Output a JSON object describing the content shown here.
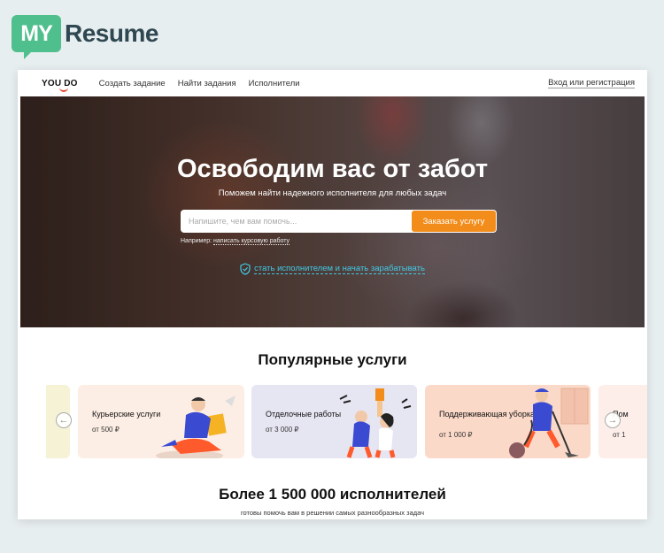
{
  "logo": {
    "badge": "MY",
    "text": "Resume"
  },
  "nav": {
    "brand": "YOU DO",
    "links": [
      "Создать задание",
      "Найти задания",
      "Исполнители"
    ],
    "login": "Вход или регистрация"
  },
  "hero": {
    "title": "Освободим вас от забот",
    "subtitle": "Поможем найти надежного исполнителя для любых задач",
    "search_placeholder": "Напишите, чем вам помочь...",
    "order_button": "Заказать услугу",
    "example_prefix": "Например:",
    "example_link": "написать курсовую работу",
    "become_link": "стать исполнителем и начать зарабатывать"
  },
  "popular": {
    "title": "Популярные услуги",
    "cards": [
      {
        "label": "Курьерские услуги",
        "price": "от 500 ₽",
        "color": "#fdeee5"
      },
      {
        "label": "Отделочные работы",
        "price": "от 3 000 ₽",
        "color": "#e6e5f2"
      },
      {
        "label": "Поддерживающая уборка",
        "price": "от 1 000 ₽",
        "color": "#fbd9c8"
      }
    ],
    "peek_right": "Пом",
    "peek_right_line2": "от 1",
    "peek_left_color": "#f5f2d6"
  },
  "stats": {
    "title": "Более 1 500 000 исполнителей",
    "subtitle": "готовы помочь вам в решении самых разнообразных задач"
  }
}
